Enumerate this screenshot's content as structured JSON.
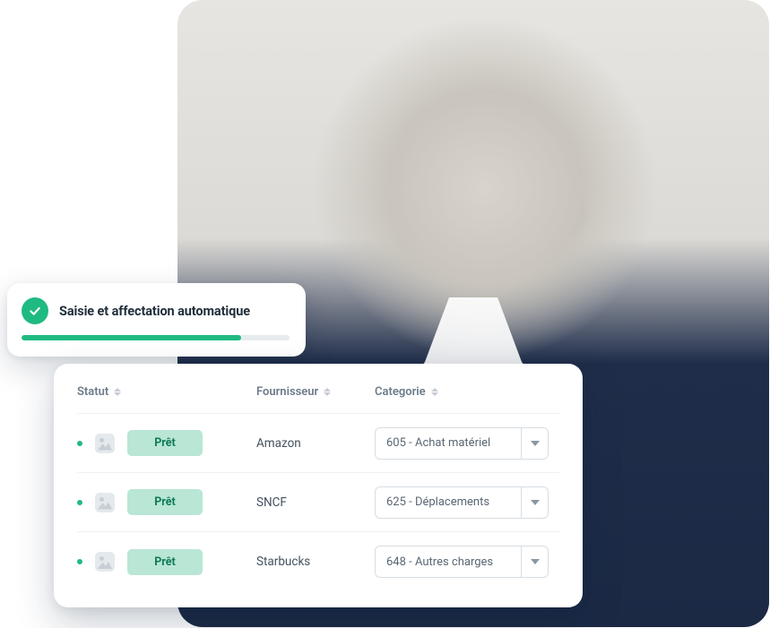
{
  "progress": {
    "title": "Saisie et affectation automatique",
    "percent": 82
  },
  "table": {
    "headers": {
      "status": "Statut",
      "supplier": "Fournisseur",
      "category": "Categorie"
    },
    "rows": [
      {
        "status": "Prêt",
        "supplier": "Amazon",
        "category": "605 - Achat matériel"
      },
      {
        "status": "Prêt",
        "supplier": "SNCF",
        "category": "625 - Déplacements"
      },
      {
        "status": "Prêt",
        "supplier": "Starbucks",
        "category": "648 - Autres charges"
      }
    ]
  },
  "colors": {
    "accent": "#1fba82",
    "pill_bg": "#b9e6d5",
    "pill_fg": "#0e7a57"
  }
}
